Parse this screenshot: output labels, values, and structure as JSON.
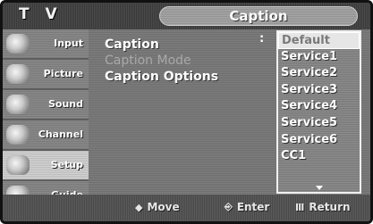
{
  "header": {
    "tv_label": "T V",
    "title": "Caption"
  },
  "sidebar": {
    "items": [
      {
        "label": "Input",
        "icon": "input-icon"
      },
      {
        "label": "Picture",
        "icon": "picture-icon"
      },
      {
        "label": "Sound",
        "icon": "sound-icon"
      },
      {
        "label": "Channel",
        "icon": "channel-icon"
      },
      {
        "label": "Setup",
        "icon": "setup-icon",
        "active": true
      },
      {
        "label": "Guide",
        "icon": "guide-icon"
      }
    ]
  },
  "main": {
    "options": [
      {
        "label": "Caption",
        "dim": false
      },
      {
        "label": "Caption Mode",
        "dim": true
      },
      {
        "label": "Caption Options",
        "dim": false
      }
    ]
  },
  "dropdown": {
    "items": [
      "Default",
      "Service1",
      "Service2",
      "Service3",
      "Service4",
      "Service5",
      "Service6",
      "CC1"
    ],
    "selected_index": 0
  },
  "footer": {
    "move": {
      "glyph": "◆",
      "label": "Move"
    },
    "enter": {
      "glyph": "⎆",
      "label": "Enter"
    },
    "return": {
      "glyph": "Ⅲ",
      "label": "Return"
    }
  }
}
